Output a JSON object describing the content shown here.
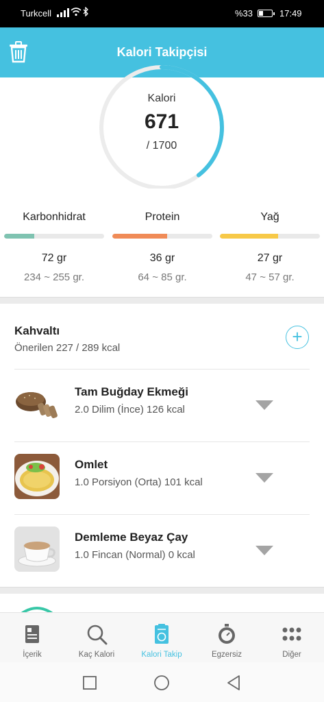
{
  "status_bar": {
    "carrier": "Turkcell",
    "battery_percent": "%33",
    "battery_level": 0.33,
    "time": "17:49"
  },
  "header": {
    "title": "Kalori Takipçisi",
    "delete_icon": "trash-icon"
  },
  "calories": {
    "label": "Kalori",
    "value": "671",
    "goal": "/ 1700",
    "progress": 0.395,
    "ring_color": "#45c1e0"
  },
  "macros": [
    {
      "name": "Karbonhidrat",
      "amount": "72 gr",
      "range": "234 ~ 255 gr.",
      "progress": 0.3,
      "color": "#7fc3b1"
    },
    {
      "name": "Protein",
      "amount": "36 gr",
      "range": "64 ~ 85 gr.",
      "progress": 0.55,
      "color": "#f08b57"
    },
    {
      "name": "Yağ",
      "amount": "27 gr",
      "range": "47 ~ 57 gr.",
      "progress": 0.58,
      "color": "#f7c948"
    }
  ],
  "meal": {
    "title": "Kahvaltı",
    "recommended": "Önerilen 227 / 289 kcal",
    "add_icon": "plus-circle-icon",
    "foods": [
      {
        "name": "Tam Buğday Ekmeği",
        "detail": "2.0 Dilim (İnce) 126 kcal",
        "image": "bread-image"
      },
      {
        "name": "Omlet",
        "detail": "1.0 Porsiyon (Orta) 101 kcal",
        "image": "omelette-image"
      },
      {
        "name": "Demleme Beyaz Çay",
        "detail": "1.0 Fincan (Normal) 0 kcal",
        "image": "tea-cup-image"
      }
    ]
  },
  "tabs": [
    {
      "label": "İçerik",
      "icon": "book-icon"
    },
    {
      "label": "Kaç Kalori",
      "icon": "search-icon"
    },
    {
      "label": "Kalori Takip",
      "icon": "clipboard-apple-icon",
      "active": true
    },
    {
      "label": "Egzersiz",
      "icon": "stopwatch-icon"
    },
    {
      "label": "Diğer",
      "icon": "grid-dots-icon"
    }
  ],
  "colors": {
    "accent": "#45c1e0",
    "muted_tab": "#666666"
  }
}
